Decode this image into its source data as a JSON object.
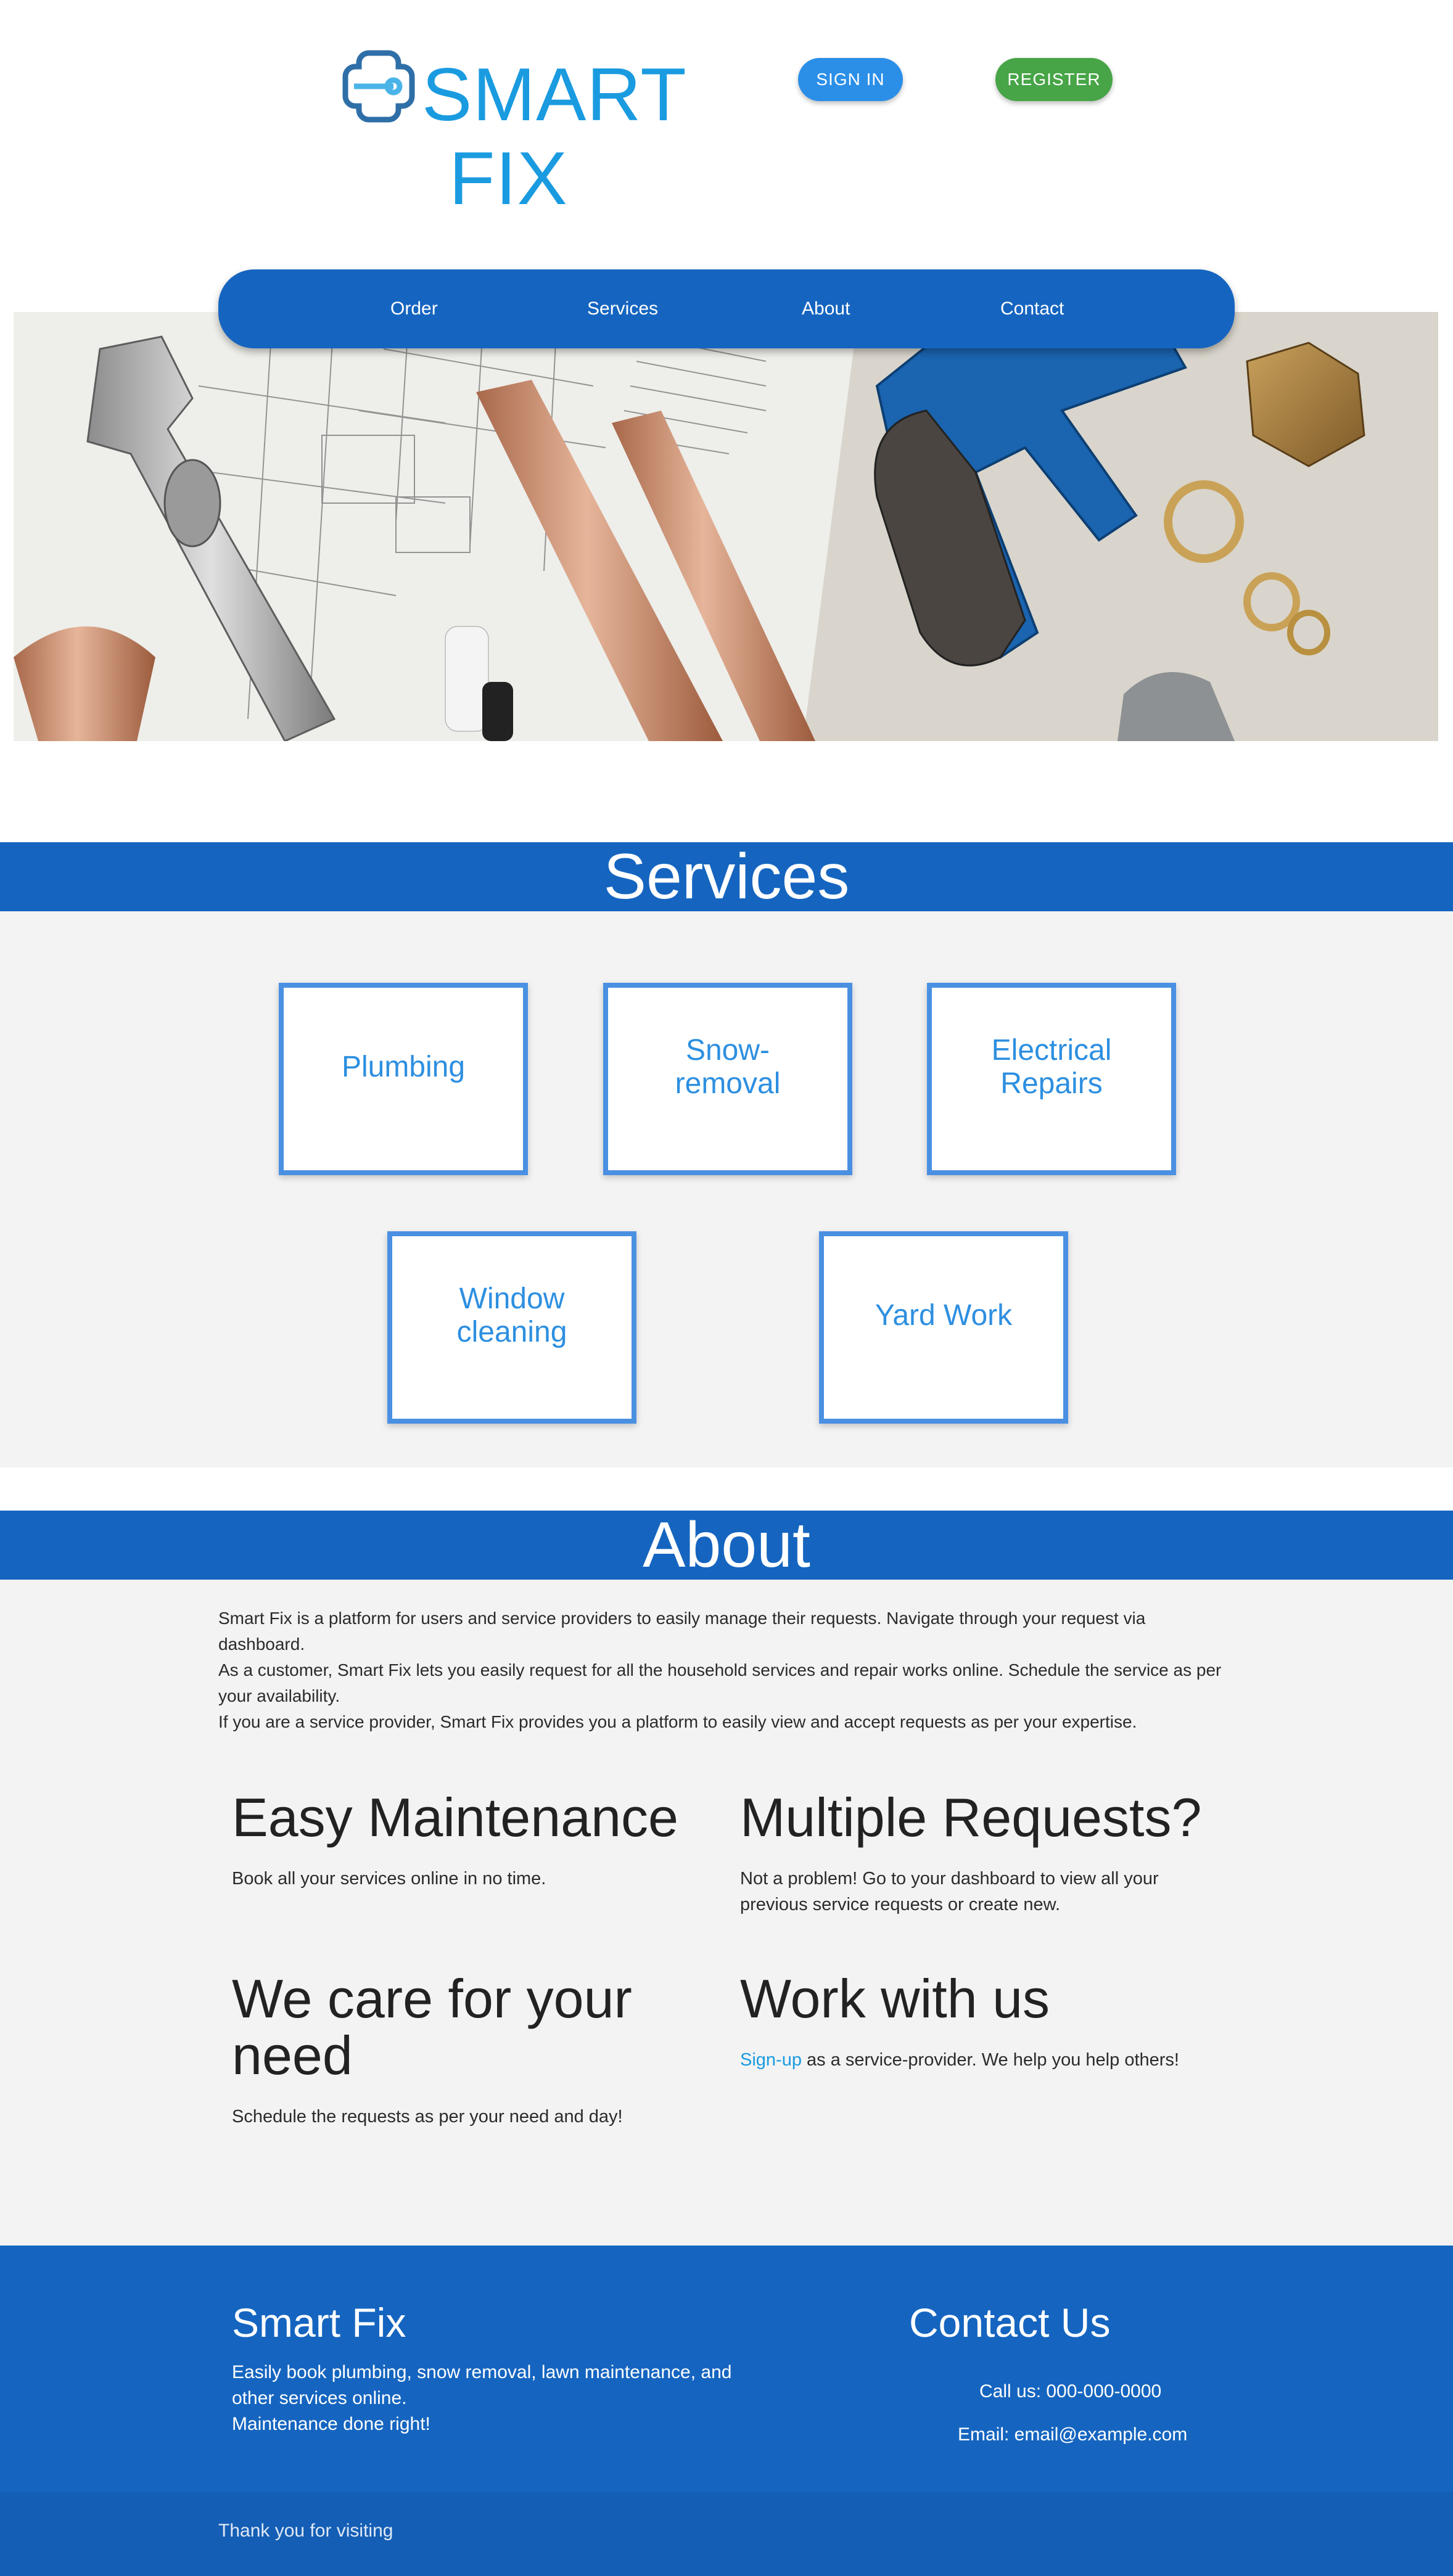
{
  "brand": {
    "line1": "SMART",
    "line2": "FIX"
  },
  "auth": {
    "signin_label": "SIGN IN",
    "register_label": "REGISTER"
  },
  "nav": {
    "items": [
      "Order",
      "Services",
      "About",
      "Contact"
    ]
  },
  "hero": {
    "icon": "plumbing-tools-photo"
  },
  "services": {
    "title": "Services",
    "cards": [
      {
        "label": "Plumbing"
      },
      {
        "label": "Snow-removal"
      },
      {
        "label": "Electrical Repairs"
      },
      {
        "label": "Window cleaning"
      },
      {
        "label": "Yard Work"
      }
    ]
  },
  "about": {
    "title": "About",
    "paragraphs": [
      "Smart Fix is a platform for users and service providers to easily manage their requests. Navigate through your request via dashboard.",
      "As a customer, Smart Fix lets you easily request for all the household services and repair works online. Schedule the service as per your availability.",
      "If you are a service provider, Smart Fix provides you a platform to easily view and accept requests as per your expertise."
    ],
    "features": [
      {
        "heading": "Easy Maintenance",
        "text": "Book all your services online in no time."
      },
      {
        "heading": "Multiple Requests?",
        "text": "Not a problem! Go to your dashboard to view all your previous service requests or create new."
      },
      {
        "heading": "We care for your need",
        "text": "Schedule the requests as per your need and day!"
      },
      {
        "heading": "Work with us",
        "link": "Sign-up",
        "text": " as a service-provider. We help you help others!"
      }
    ]
  },
  "footer": {
    "brand_title": "Smart Fix",
    "description": "Easily book plumbing, snow removal, lawn maintenance, and other services online.",
    "tagline": "Maintenance done right!",
    "contact_title": "Contact Us",
    "call": "Call us: 000-000-0000",
    "email": "Email: email@example.com",
    "thanks": "Thank you for visiting"
  },
  "colors": {
    "primary": "#1565c0",
    "accent": "#1a9be0",
    "register": "#47a547",
    "signin": "#2b8fe8",
    "card_border": "#4a90e2"
  }
}
